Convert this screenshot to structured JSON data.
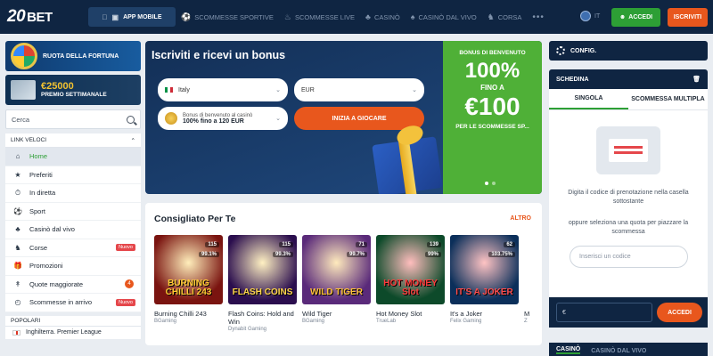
{
  "header": {
    "logo_num": "20",
    "logo_text": "BET",
    "app_mobile": "APP MOBILE",
    "nav": [
      "SCOMMESSE SPORTIVE",
      "SCOMMESSE LIVE",
      "CASINÒ",
      "CASINÒ DAL VIVO",
      "CORSA"
    ],
    "more": "•••",
    "lang": "IT",
    "login": "ACCEDI",
    "register": "ISCRIVITI"
  },
  "sidebar": {
    "promo1": "RUOTA DELLA FORTUNA",
    "promo2_amount": "€25000",
    "promo2_sub": "PREMIO SETTIMANALE",
    "search_placeholder": "Cerca",
    "links_title": "LINK VELOCI",
    "items": [
      {
        "label": "Home"
      },
      {
        "label": "Preferiti"
      },
      {
        "label": "In diretta"
      },
      {
        "label": "Sport"
      },
      {
        "label": "Casinò dal vivo"
      },
      {
        "label": "Corse",
        "badge": "Nuovo"
      },
      {
        "label": "Promozioni"
      },
      {
        "label": "Quote maggiorate",
        "count": "4"
      },
      {
        "label": "Scommesse in arrivo",
        "badge": "Nuovo"
      }
    ],
    "popular_title": "POPOLARI",
    "popular_first": "Inghilterra. Premier League"
  },
  "banner": {
    "title": "Iscriviti e ricevi un bonus",
    "country": "Italy",
    "currency": "EUR",
    "bonus_line1": "Bonus di benvenuto al casinò",
    "bonus_line2": "100% fino a 120 EUR",
    "cta": "INIZIA A GIOCARE",
    "panel": {
      "heading": "BONUS DI BENVENUTO",
      "percent": "100%",
      "fino": "FINO A",
      "amount": "€100",
      "sub": "PER LE SCOMMESSE SP..."
    }
  },
  "recommended": {
    "title": "Consigliato Per Te",
    "all": "ALTRO",
    "games": [
      {
        "title": "Burning Chilli 243",
        "provider": "BGaming",
        "art": "BURNING CHILLI 243",
        "players": "115",
        "rtp": "99.1%",
        "bg": "#7a1410",
        "fg": "#ffcc33"
      },
      {
        "title": "Flash Coins: Hold and Win",
        "provider": "Dynabit Gaming",
        "art": "FLASH COINS",
        "players": "115",
        "rtp": "99.3%",
        "bg": "#2b0e4e",
        "fg": "#ffd54a"
      },
      {
        "title": "Wild Tiger",
        "provider": "BGaming",
        "art": "WILD TIGER",
        "players": "71",
        "rtp": "99.7%",
        "bg": "#5a2a7a",
        "fg": "#ffc23a"
      },
      {
        "title": "Hot Money Slot",
        "provider": "TrueLab",
        "art": "HOT MONEY Slot",
        "players": "139",
        "rtp": "99%",
        "bg": "#0d4a2a",
        "fg": "#ff3b3b"
      },
      {
        "title": "It's a Joker",
        "provider": "Felix Gaming",
        "art": "IT'S A JOKER",
        "players": "62",
        "rtp": "103.75%",
        "bg": "#0b2f5a",
        "fg": "#ff4d4d"
      },
      {
        "title": "M",
        "provider": "Z",
        "art": "",
        "players": "",
        "rtp": "",
        "bg": "#2a2a2a",
        "fg": "#fff"
      }
    ]
  },
  "betslip": {
    "config": "CONFIG.",
    "title": "SCHEDINA",
    "tab_single": "SINGOLA",
    "tab_multi": "SCOMMESSA MULTIPLA",
    "msg": "Digita il codice di prenotazione nella casella sottostante",
    "or": "oppure seleziona una quota per piazzare la scommessa",
    "code_placeholder": "Inserisci un codice",
    "currency": "€",
    "login": "ACCEDI"
  },
  "casino_tabs": [
    "CASINÒ",
    "CASINÒ DAL VIVO"
  ]
}
